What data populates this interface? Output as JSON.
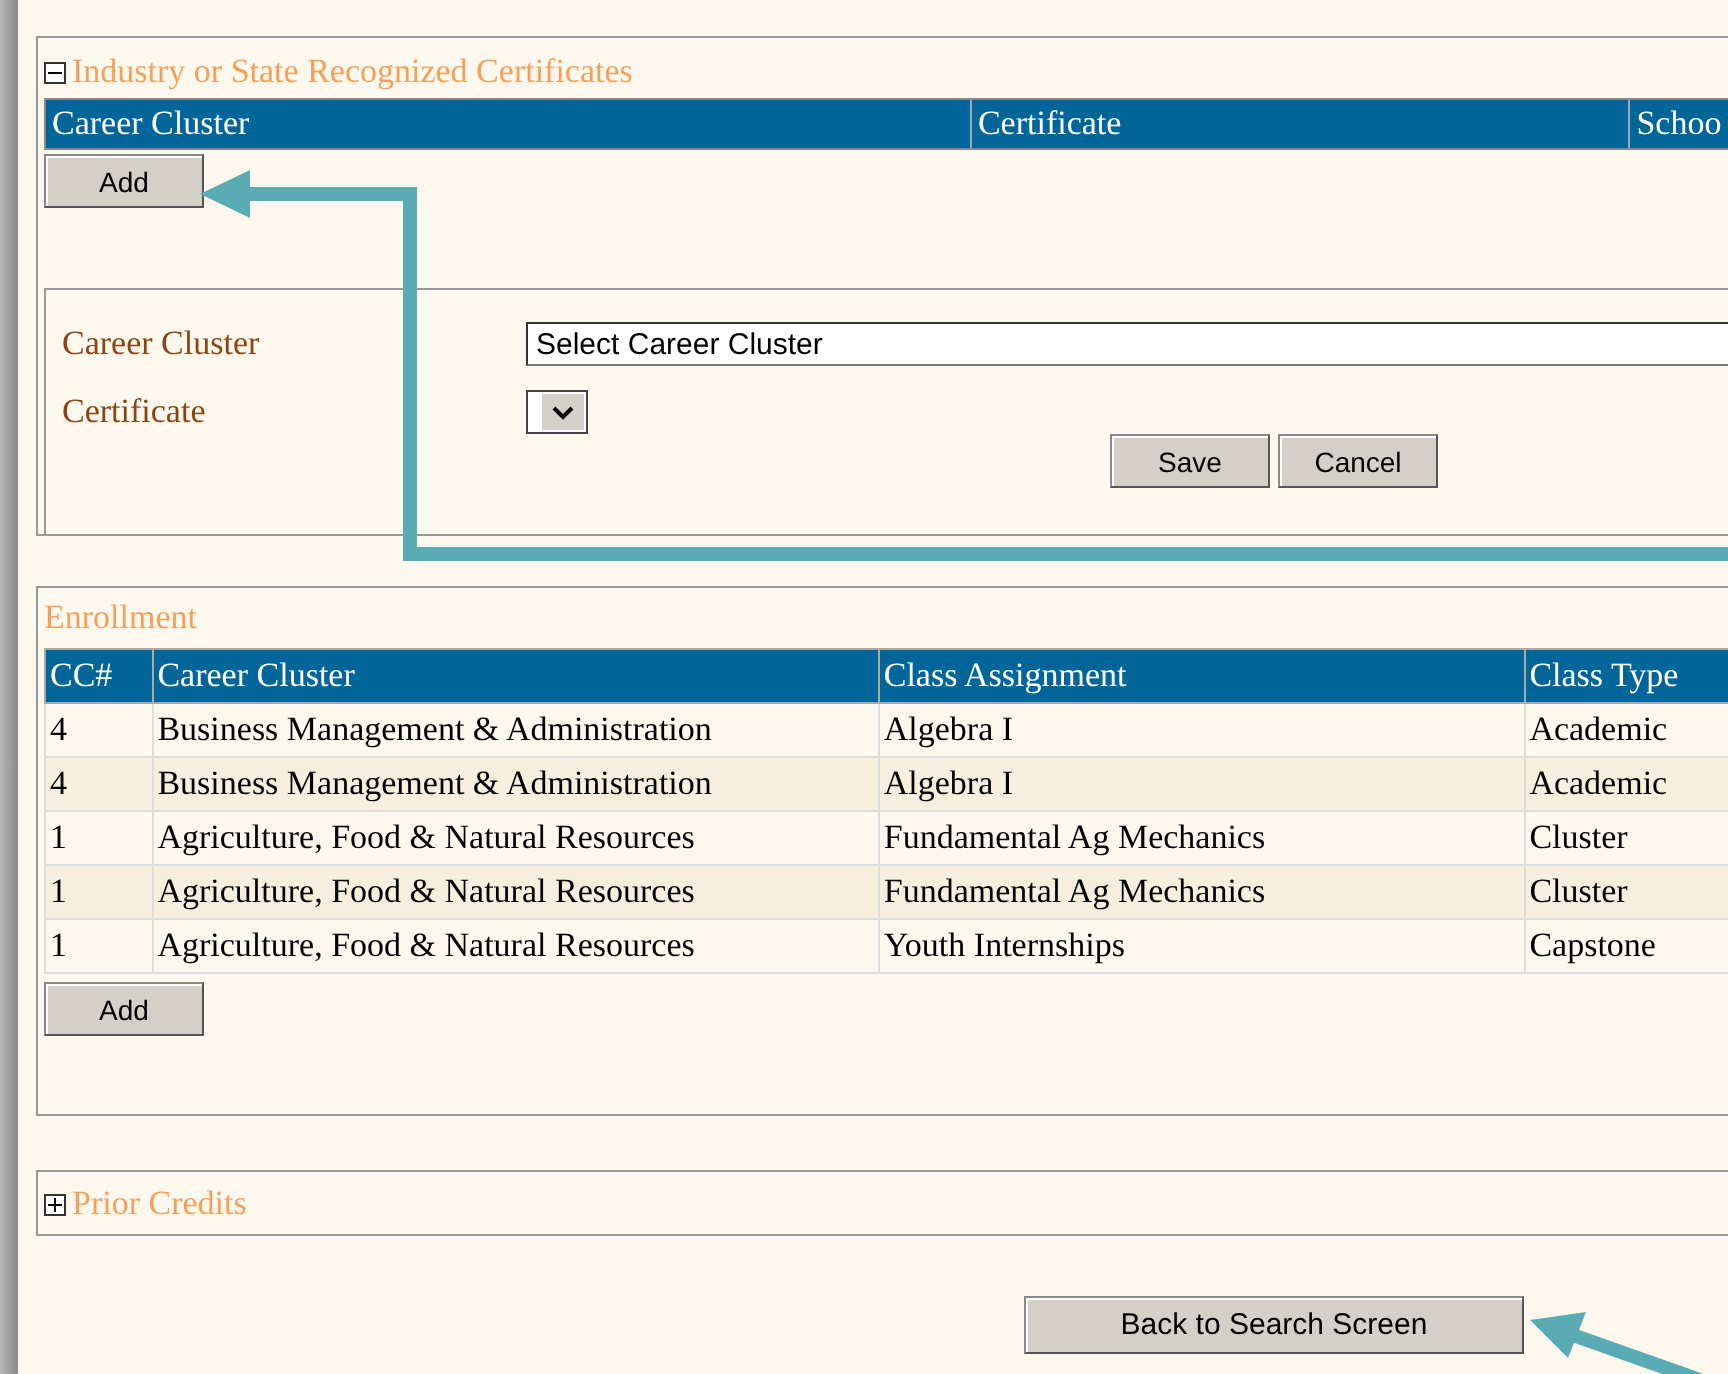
{
  "certificates": {
    "title": "Industry or State Recognized Certificates",
    "expanded": true,
    "columns": [
      "Career Cluster",
      "Certificate",
      "Schoo"
    ],
    "add_button": "Add",
    "form": {
      "fields": [
        {
          "label": "Career Cluster",
          "kind": "select",
          "value": "Select Career Cluster"
        },
        {
          "label": "Certificate",
          "kind": "dropdown"
        }
      ],
      "buttons": [
        "Save",
        "Cancel"
      ]
    }
  },
  "enrollment": {
    "title": "Enrollment",
    "columns": [
      "CC#",
      "Career Cluster",
      "Class Assignment",
      "Class Type"
    ],
    "rows": [
      [
        "4",
        "Business Management & Administration",
        "Algebra I",
        "Academic"
      ],
      [
        "4",
        "Business Management & Administration",
        "Algebra I",
        "Academic"
      ],
      [
        "1",
        "Agriculture, Food & Natural Resources",
        "Fundamental Ag Mechanics",
        "Cluster"
      ],
      [
        "1",
        "Agriculture, Food & Natural Resources",
        "Fundamental Ag Mechanics",
        "Cluster"
      ],
      [
        "1",
        "Agriculture, Food & Natural Resources",
        "Youth Internships",
        "Capstone"
      ]
    ],
    "add_button": "Add"
  },
  "prior_credits": {
    "title": "Prior Credits",
    "expanded": false
  },
  "back_button": "Back to Search Screen"
}
